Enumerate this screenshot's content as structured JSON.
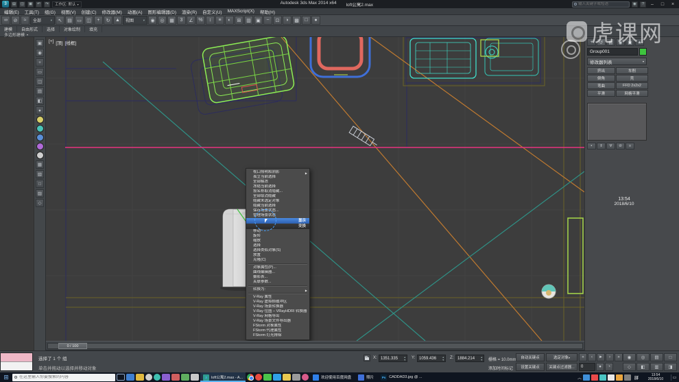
{
  "colors": {
    "selection_green": "#8dee55",
    "line_pink": "#e8337f",
    "line_orange": "#c07a30",
    "line_teal": "#2f9186",
    "tube_blue": "#3f6fd8",
    "tube_red": "#e0685e",
    "furniture_teal": "#3fe0cc",
    "swatch_green": "#3ec43e",
    "quad_title_blue": "#2f6fc0"
  },
  "window": {
    "app_title": "Autodesk 3ds Max 2014 x64",
    "doc_title": "loft公寓2.max",
    "workspace": "工作区: 默认",
    "infocenter_placeholder": "输入关键字或短语",
    "min": "–",
    "max": "□",
    "close": "×"
  },
  "menubar": [
    "编辑(E)",
    "工具(T)",
    "组(G)",
    "视图(V)",
    "创建(C)",
    "修改器(M)",
    "动画(A)",
    "图形编辑器(D)",
    "渲染(R)",
    "自定义(U)",
    "MAXScript(X)",
    "帮助(H)"
  ],
  "toolbar": {
    "items": [
      {
        "name": "select-and-link-icon",
        "glyph": "∞"
      },
      {
        "name": "unlink-selection-icon",
        "glyph": "⊘"
      },
      {
        "name": "bind-to-spacewarp-icon",
        "glyph": "≈"
      },
      {
        "name": "selection-filter-dropdown",
        "type": "dropdown",
        "value": "全部"
      },
      {
        "name": "select-object-icon",
        "glyph": "↖"
      },
      {
        "name": "select-by-name-icon",
        "glyph": "▤"
      },
      {
        "name": "rectangular-region-icon",
        "glyph": "▭"
      },
      {
        "name": "window-crossing-icon",
        "glyph": "◫"
      },
      {
        "name": "select-and-move-icon",
        "glyph": "+"
      },
      {
        "name": "select-and-rotate-icon",
        "glyph": "↻"
      },
      {
        "name": "select-and-scale-icon",
        "glyph": "▲"
      },
      {
        "name": "reference-coordinate-dropdown",
        "type": "dropdown",
        "value": "视图"
      },
      {
        "name": "use-pivot-center-icon",
        "glyph": "◉"
      },
      {
        "name": "select-and-manipulate-icon",
        "glyph": "◎"
      },
      {
        "name": "keyboard-override-icon",
        "glyph": "▦"
      },
      {
        "name": "snaps-toggle-icon",
        "glyph": "3"
      },
      {
        "name": "angle-snap-icon",
        "glyph": "∠"
      },
      {
        "name": "percent-snap-icon",
        "glyph": "%"
      },
      {
        "name": "spinner-snap-icon",
        "glyph": "↕"
      },
      {
        "name": "named-selection-sets-icon",
        "glyph": "≡"
      },
      {
        "name": "mirror-icon",
        "glyph": "◐"
      },
      {
        "name": "align-icon",
        "glyph": "⊞"
      },
      {
        "name": "layer-manager-icon",
        "glyph": "▥"
      },
      {
        "name": "graphite-ribbon-icon",
        "glyph": "▣"
      },
      {
        "name": "curve-editor-icon",
        "glyph": "~"
      },
      {
        "name": "schematic-view-icon",
        "glyph": "⊡"
      },
      {
        "name": "material-editor-icon",
        "glyph": "◑"
      },
      {
        "name": "render-setup-icon",
        "glyph": "▩"
      },
      {
        "name": "rendered-frame-icon",
        "glyph": "□"
      },
      {
        "name": "render-production-icon",
        "glyph": "●"
      }
    ]
  },
  "ribbon": {
    "tabs": [
      "建模",
      "自由形式",
      "选择",
      "对象绘制",
      "填充"
    ],
    "panel": "多边形建模"
  },
  "left_toolbar": [
    {
      "name": "left-tool-icon-1",
      "glyph": "▣"
    },
    {
      "name": "left-tool-icon-2",
      "glyph": "◉"
    },
    {
      "name": "left-tool-icon-3",
      "glyph": "+"
    },
    {
      "name": "left-tool-icon-4",
      "glyph": "▭"
    },
    {
      "name": "left-tool-icon-5",
      "glyph": "◫"
    },
    {
      "name": "left-tool-icon-6",
      "glyph": "▤"
    },
    {
      "name": "left-tool-icon-7",
      "glyph": "◧"
    },
    {
      "name": "left-tool-icon-8",
      "glyph": "●"
    },
    {
      "name": "left-tool-icon-9",
      "color": "#d8cf6a"
    },
    {
      "name": "left-tool-icon-10",
      "color": "#4ac3b8"
    },
    {
      "name": "left-tool-icon-11",
      "color": "#5a8fd8"
    },
    {
      "name": "left-tool-icon-12",
      "color": "#b06ad8"
    },
    {
      "name": "left-tool-icon-13",
      "color": "#d0d0d0"
    },
    {
      "name": "left-tool-icon-14",
      "glyph": "▦"
    },
    {
      "name": "left-tool-icon-15",
      "glyph": "▧"
    },
    {
      "name": "left-tool-icon-16",
      "glyph": "□"
    },
    {
      "name": "left-tool-icon-17",
      "glyph": "▨"
    },
    {
      "name": "left-tool-icon-18",
      "glyph": "◇"
    }
  ],
  "viewport": {
    "label_plus": "[+]",
    "label_view": "[顶]",
    "label_shading": "[线框]"
  },
  "quad_menu": {
    "display_title": "显示",
    "transform_title": "变换",
    "display_items": [
      {
        "label": "视口照明和阴影",
        "submenu": true
      },
      {
        "label": "孤立当前选择"
      },
      {
        "label": "全部解冻"
      },
      {
        "label": "冻结当前选择"
      },
      {
        "label": "按名称取消隐藏..."
      },
      {
        "label": "全部取消隐藏"
      },
      {
        "label": "隐藏未选定对象"
      },
      {
        "label": "隐藏当前选择"
      },
      {
        "label": "保存场景状态..."
      },
      {
        "label": "管理场景状态"
      }
    ],
    "transform_items": [
      {
        "label": "移动"
      },
      {
        "label": "旋转"
      },
      {
        "label": "缩放"
      },
      {
        "label": "选择"
      },
      {
        "label": "选择类似对象(S)"
      },
      {
        "label": "放置"
      },
      {
        "label": "克隆(C)"
      },
      {
        "label": "对象属性(P)...",
        "pre_sep": true
      },
      {
        "label": "曲线编辑器..."
      },
      {
        "label": "摄影表..."
      },
      {
        "label": "关联参数..."
      },
      {
        "label": "转换为:",
        "submenu": true,
        "pre_sep": true
      }
    ],
    "plugin_items": [
      {
        "label": "V-Ray 属性"
      },
      {
        "label": "V-Ray 虚拟帧缓冲区"
      },
      {
        "label": "V-Ray 场景转换器"
      },
      {
        "label": "V-Ray 位图 – VRayHDRI 转换器"
      },
      {
        "label": "V-Ray 网格导出"
      },
      {
        "label": "V-Ray 场景文件导出器"
      },
      {
        "label": "FStorm 对象属性"
      },
      {
        "label": "FStorm 代理属性"
      },
      {
        "label": "FStorm 灯光排除"
      }
    ]
  },
  "command_panel": {
    "tabs": [
      {
        "name": "create-tab",
        "glyph": "+",
        "active": false
      },
      {
        "name": "modify-tab",
        "glyph": "↺",
        "active": true
      },
      {
        "name": "hierarchy-tab",
        "glyph": "▤",
        "active": false
      },
      {
        "name": "motion-tab",
        "glyph": "◉",
        "active": false
      },
      {
        "name": "display-tab",
        "glyph": "▣",
        "active": false
      },
      {
        "name": "utilities-tab",
        "glyph": "★",
        "active": false
      }
    ],
    "object_name": "Group001",
    "modifier_list": "修改器列表",
    "modifier_buttons": [
      [
        "挤出",
        "车削"
      ],
      [
        "倒角",
        "壳"
      ],
      [
        "弯曲",
        "FFD 2x2x2"
      ],
      [
        "平滑",
        "网格平滑"
      ]
    ],
    "stack_tools": [
      {
        "name": "pin-stack-icon",
        "glyph": "▪"
      },
      {
        "name": "show-end-result-icon",
        "glyph": "‖"
      },
      {
        "name": "make-unique-icon",
        "glyph": "∀"
      },
      {
        "name": "remove-modifier-icon",
        "glyph": "⊘"
      },
      {
        "name": "configure-modifier-sets-icon",
        "glyph": "≡"
      }
    ]
  },
  "status": {
    "timeline_label": "0 / 100",
    "selection_info": "选择了 1 个 组",
    "prompt": "单击并拖动以选择并移动对象",
    "x_label": "X:",
    "x": "1351.335",
    "y_label": "Y:",
    "y": "1059.436",
    "z_label": "Z:",
    "z": "1884.214",
    "grid_label": "栅格 = 10.0mm",
    "add_time_tag": "添加时间标记",
    "auto_key": "自动关键点",
    "set_key": "设置关键点",
    "selected_filter": "选定对象",
    "key_filters": "关键点过滤器...",
    "frame": "0",
    "playback": [
      {
        "name": "go-to-start-button",
        "glyph": "«"
      },
      {
        "name": "previous-frame-button",
        "glyph": "‹"
      },
      {
        "name": "play-button",
        "glyph": "►"
      },
      {
        "name": "next-frame-button",
        "glyph": "›"
      },
      {
        "name": "go-to-end-button",
        "glyph": "»"
      }
    ],
    "playback2": [
      {
        "name": "key-mode-toggle-button",
        "glyph": "●"
      },
      {
        "name": "time-configuration-button",
        "glyph": "◔"
      }
    ],
    "nav1": [
      {
        "name": "zoom-icon",
        "glyph": "◉"
      },
      {
        "name": "zoom-all-icon",
        "glyph": "◎"
      },
      {
        "name": "zoom-extents-icon",
        "glyph": "▤"
      },
      {
        "name": "zoom-region-icon",
        "glyph": "□"
      }
    ],
    "nav2": [
      {
        "name": "field-of-view-icon",
        "glyph": "◇"
      },
      {
        "name": "pan-view-icon",
        "glyph": "◧"
      },
      {
        "name": "orbit-icon",
        "glyph": "▥"
      },
      {
        "name": "maximize-viewport-icon",
        "glyph": "◨"
      }
    ]
  },
  "watermark": {
    "brand": "虎课网",
    "time": "13:54",
    "date": "2018/6/10"
  },
  "taskbar": {
    "search_placeholder": "在这里输入你要搜索的内容",
    "app_icons_1": [
      {
        "name": "taskbar-app-icon-1",
        "color": "#3f7fd0",
        "shape": "square"
      },
      {
        "name": "taskbar-app-icon-2",
        "color": "#e0b93f",
        "shape": "square"
      },
      {
        "name": "taskbar-app-icon-3",
        "color": "#cfcfcf",
        "shape": "circle"
      },
      {
        "name": "taskbar-app-icon-4",
        "color": "#3fbfb0",
        "shape": "circle"
      },
      {
        "name": "taskbar-app-icon-5",
        "color": "#8a5fd0",
        "shape": "square"
      },
      {
        "name": "taskbar-app-icon-6",
        "color": "#d05f5f",
        "shape": "square"
      },
      {
        "name": "taskbar-app-icon-7",
        "color": "#5fae5f",
        "shape": "square"
      },
      {
        "name": "taskbar-app-icon-8",
        "color": "#c8c8c8",
        "shape": "square"
      }
    ],
    "app_icons_2": [
      {
        "name": "chrome-icon",
        "chrome": true
      },
      {
        "name": "taskbar-app-icon-9",
        "color": "#e84a3f",
        "shape": "circle"
      },
      {
        "name": "taskbar-app-icon-10",
        "color": "#4ac34a",
        "shape": "square"
      },
      {
        "name": "taskbar-app-icon-11",
        "color": "#30a0e8",
        "shape": "square"
      },
      {
        "name": "taskbar-app-icon-12",
        "color": "#e8c850",
        "shape": "square"
      },
      {
        "name": "taskbar-app-icon-13",
        "color": "#9a9a9a",
        "shape": "square"
      },
      {
        "name": "taskbar-app-icon-14",
        "color": "#d85a8a",
        "shape": "circle"
      }
    ],
    "windows": [
      {
        "label": "loft公寓2.max - A...",
        "icon_color": "#2e9b8f",
        "icon_text": "3",
        "active": true
      },
      {
        "label": "欢迎使用百度网盘",
        "icon_color": "#2f7fe8",
        "icon_text": ""
      },
      {
        "label": "照片",
        "icon_color": "#3f6fd8",
        "icon_text": ""
      },
      {
        "label": "CADDAD3.jpg @ ...",
        "icon_color": "#0c2233",
        "icon_text": "Ps"
      }
    ],
    "tray_icons": [
      {
        "name": "tray-icon-1",
        "color": "#3f8fd8"
      },
      {
        "name": "tray-icon-2",
        "color": "#e84a4a"
      },
      {
        "name": "tray-icon-3",
        "color": "#4ac3c3"
      },
      {
        "name": "tray-icon-4",
        "color": "#e8e8e8"
      },
      {
        "name": "tray-icon-5",
        "color": "#e8a43f"
      },
      {
        "name": "tray-icon-6",
        "color": "#7f7f7f"
      }
    ],
    "ime": "拼",
    "time": "13:54",
    "date": "2018/6/10"
  }
}
